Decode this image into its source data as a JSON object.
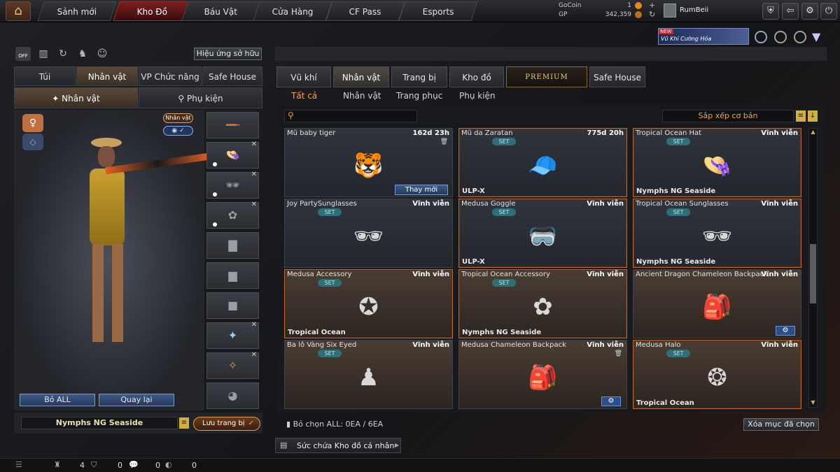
{
  "topnav": {
    "tabs": [
      "Sảnh mới",
      "Kho Đồ",
      "Báu Vật",
      "Cửa Hàng",
      "CF Pass",
      "Esports"
    ],
    "active_tab": "Kho Đồ"
  },
  "currency": {
    "gocoin_label": "GoCoin",
    "gocoin_value": "1",
    "gp_label": "GP",
    "gp_value": "342,359"
  },
  "user": {
    "name": "RumBeii"
  },
  "banner": {
    "new_label": "NEW",
    "text": "Vũ Khí Cường Hóa"
  },
  "left": {
    "effect_button": "Hiệu ứng sở hữu",
    "tabs": [
      "Túi",
      "Nhân vật",
      "VP Chức năng",
      "Safe House"
    ],
    "active_tab": "Nhân vật",
    "subtabs": [
      "Nhân vật",
      "Phụ kiện"
    ],
    "char_badge": "Nhân vật",
    "remove_all": "Bỏ ALL",
    "back": "Quay lại",
    "preset_name": "Nymphs NG Seaside",
    "save_button": "Lưu trang bị"
  },
  "right": {
    "tabs": [
      "Vũ khí",
      "Nhân vật",
      "Trang bị",
      "Kho đồ",
      "PREMIUM",
      "Safe House"
    ],
    "active_tab": "Nhân vật",
    "filters": [
      "Tất cả",
      "Nhân vật",
      "Trang phục",
      "Phụ kiện"
    ],
    "active_filter": "Tất cả",
    "search_placeholder": "",
    "sort_label": "Sắp xếp cơ bản",
    "items": [
      {
        "name": "Mũ baby tiger",
        "duration": "162d 23h",
        "set": "",
        "footer": "",
        "icon": "tiger-hat",
        "glyph": "🐯",
        "action": "Thay mới"
      },
      {
        "name": "Mũ da Zaratan",
        "duration": "775d 20h",
        "set": "SET",
        "footer": "ULP-X",
        "icon": "cap",
        "glyph": "🧢",
        "action": ""
      },
      {
        "name": "Tropical Ocean Hat",
        "duration": "Vĩnh viễn",
        "set": "SET",
        "footer": "Nymphs NG Seaside",
        "icon": "straw-hat",
        "glyph": "👒",
        "action": ""
      },
      {
        "name": "Joy PartySunglasses",
        "duration": "Vĩnh viễn",
        "set": "SET",
        "footer": "",
        "icon": "sunglasses",
        "glyph": "🕶",
        "action": ""
      },
      {
        "name": "Medusa Goggle",
        "duration": "Vĩnh viễn",
        "set": "SET",
        "footer": "ULP-X",
        "icon": "goggle",
        "glyph": "🥽",
        "action": ""
      },
      {
        "name": "Tropical Ocean Sunglasses",
        "duration": "Vĩnh viễn",
        "set": "SET",
        "footer": "Nymphs NG Seaside",
        "icon": "sunglasses",
        "glyph": "🕶",
        "action": ""
      },
      {
        "name": "Medusa Accessory",
        "duration": "Vĩnh viễn",
        "set": "SET",
        "footer": "Tropical Ocean",
        "icon": "emblem",
        "glyph": "✪",
        "action": ""
      },
      {
        "name": "Tropical Ocean Accessory",
        "duration": "Vĩnh viễn",
        "set": "SET",
        "footer": "Nymphs NG Seaside",
        "icon": "flower",
        "glyph": "✿",
        "action": ""
      },
      {
        "name": "Ancient Dragon Chameleon Backpack",
        "duration": "Vĩnh viễn",
        "set": "",
        "footer": "",
        "icon": "backpack",
        "glyph": "🎒",
        "action": "gear"
      },
      {
        "name": "Ba lô Vàng Six Eyed",
        "duration": "Vĩnh viễn",
        "set": "SET",
        "footer": "",
        "icon": "figure",
        "glyph": "♟",
        "action": ""
      },
      {
        "name": "Medusa Chameleon Backpack",
        "duration": "Vĩnh viễn",
        "set": "",
        "footer": "",
        "icon": "backpack",
        "glyph": "🎒",
        "action": "gear"
      },
      {
        "name": "Medusa Halo",
        "duration": "Vĩnh viễn",
        "set": "SET",
        "footer": "Tropical Ocean",
        "icon": "halo",
        "glyph": "❂",
        "action": ""
      }
    ],
    "selected_text": "Bỏ chọn ALL: 0EA / 6EA",
    "clear_button": "Xóa mục đã chọn",
    "capacity_label": "Sức chứa Kho đồ cá nhân"
  },
  "status": {
    "count1": "4",
    "count2": "0",
    "count3": "0",
    "count4": "0"
  },
  "colors": {
    "accent": "#f2a64a",
    "active_tab": "#7a1e1e",
    "card_border_gold": "#c0682a"
  }
}
